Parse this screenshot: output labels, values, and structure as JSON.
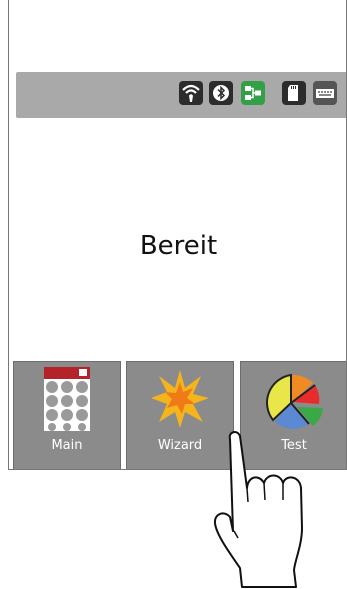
{
  "status": {
    "text": "Bereit",
    "icons": [
      "wifi-icon",
      "bluetooth-icon",
      "ethernet-icon",
      "sd-card-icon",
      "keyboard-icon"
    ],
    "colors": {
      "bar": "#a9a9a9",
      "icon_bg": "#2c2c2c",
      "active_icon_bg": "#33a047"
    }
  },
  "tabs": [
    {
      "label": "Main",
      "icon": "main-grid-icon"
    },
    {
      "label": "Wizard",
      "icon": "wizard-burst-icon"
    },
    {
      "label": "Test",
      "icon": "test-pie-icon"
    }
  ],
  "overlay": {
    "icon": "pointing-hand-icon"
  }
}
